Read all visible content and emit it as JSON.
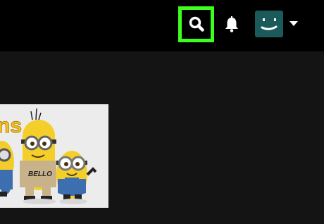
{
  "header": {
    "search_icon": "search-icon",
    "notifications_icon": "bell-icon",
    "profile_icon": "profile-avatar-icon",
    "profile_menu_icon": "caret-down-icon",
    "highlight_color": "#3dff1e",
    "avatar_color": "#1b5a5a"
  },
  "content": {
    "title_card": {
      "partial_logo_text": "ns",
      "shirt_text": "BELLO"
    }
  }
}
